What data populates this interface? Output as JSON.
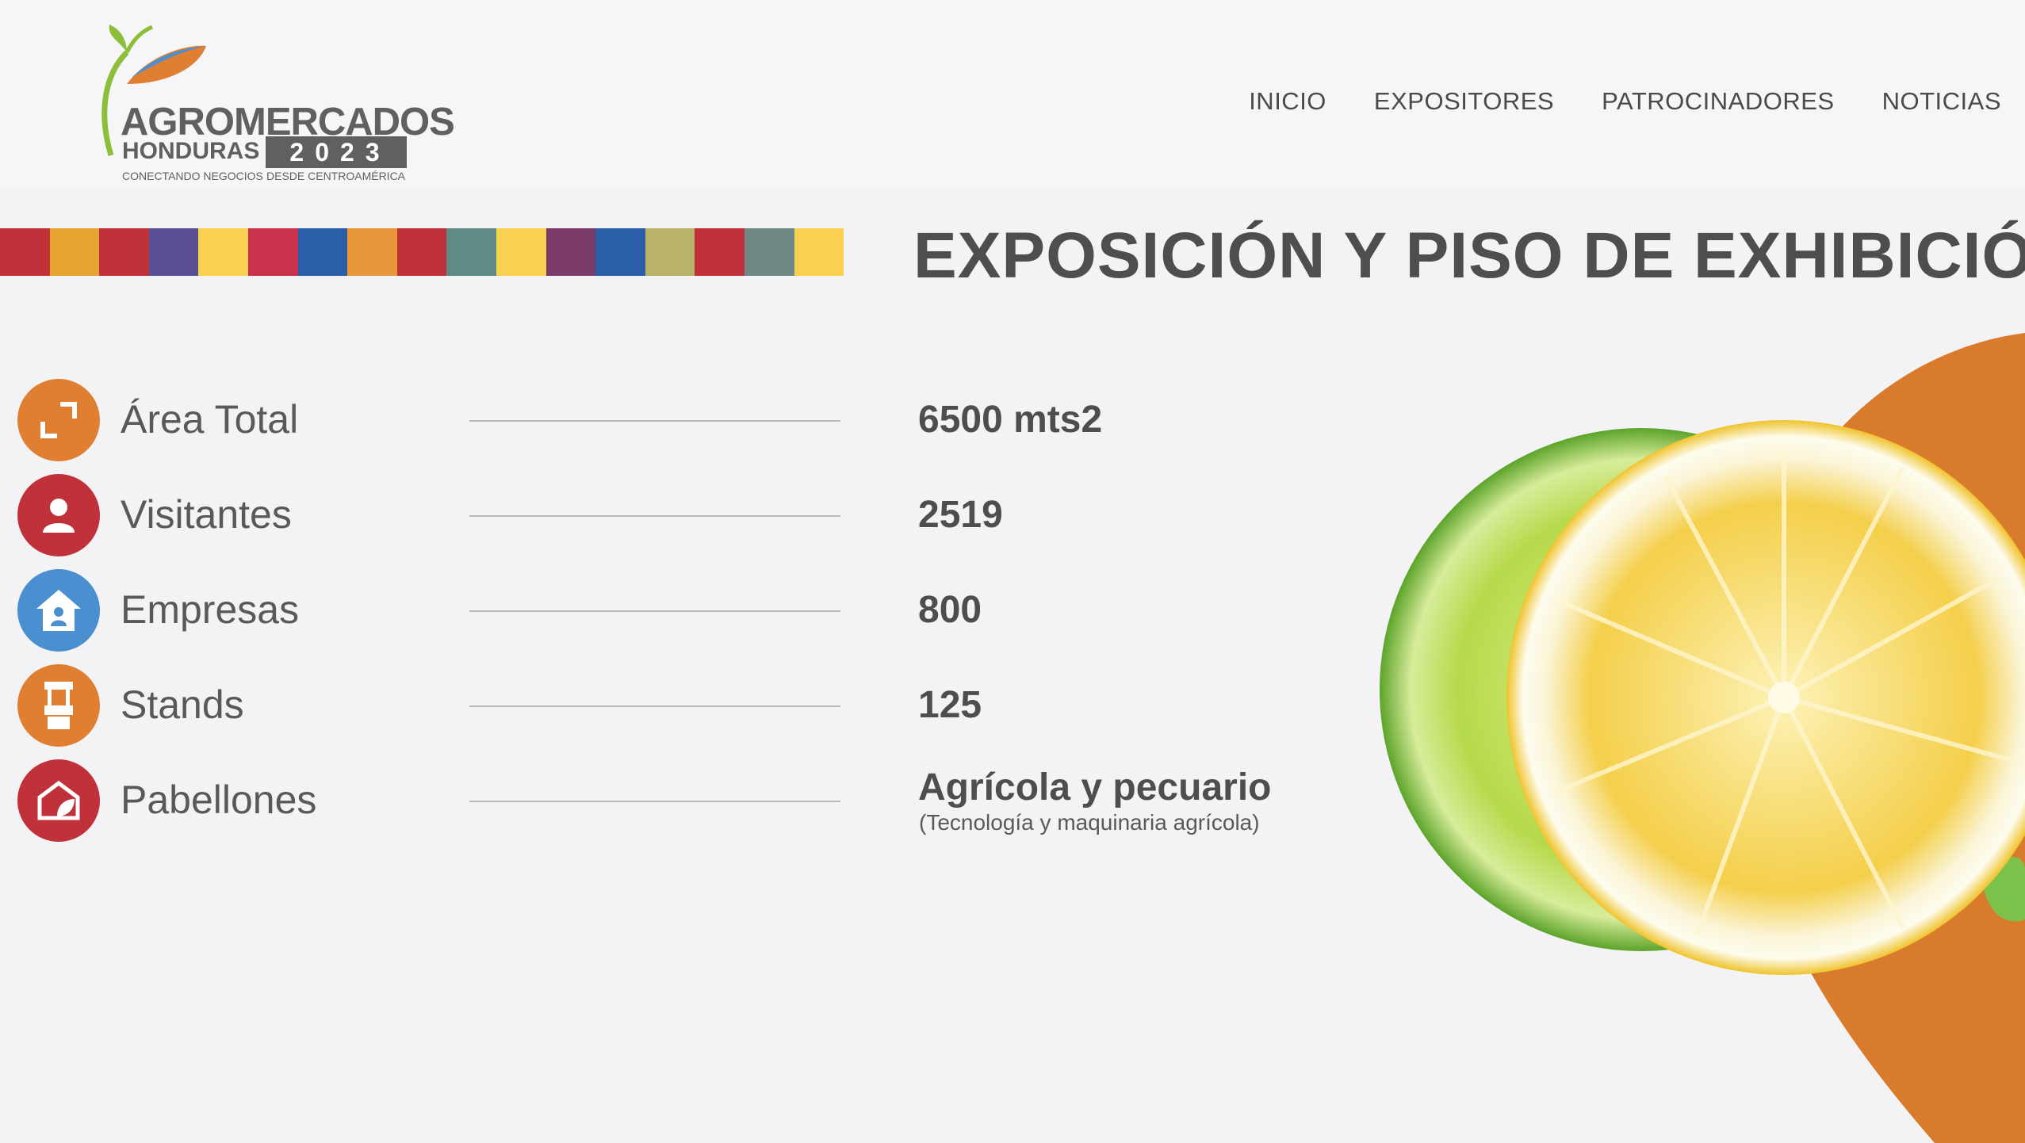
{
  "brand": {
    "name": "AGROMERCADOS",
    "country": "HONDURAS",
    "year": "2023",
    "tagline_left": "CONECTANDO NEGOCIOS",
    "tagline_right": "DESDE CENTROAMÉRICA"
  },
  "nav": {
    "items": [
      {
        "label": "INICIO"
      },
      {
        "label": "EXPOSITORES"
      },
      {
        "label": "PATROCINADORES"
      },
      {
        "label": "NOTICIAS"
      }
    ]
  },
  "section": {
    "title": "EXPOSICIÓN Y PISO DE EXHIBICIÓN"
  },
  "stats": [
    {
      "label": "Área Total",
      "value": "6500 mts2",
      "icon": "expand-icon",
      "color": "#e07f32"
    },
    {
      "label": "Visitantes",
      "value": "2519",
      "icon": "user-icon",
      "color": "#c0313a"
    },
    {
      "label": "Empresas",
      "value": "800",
      "icon": "building-icon",
      "color": "#4a8fcf"
    },
    {
      "label": "Stands",
      "value": "125",
      "icon": "stand-icon",
      "color": "#e07f32"
    },
    {
      "label": "Pabellones",
      "value": "Agrícola y pecuario",
      "note": "(Tecnología y maquinaria agrícola)",
      "icon": "pavilion-icon",
      "color": "#c0313a"
    }
  ],
  "colors": {
    "orange": "#e07f32",
    "red": "#c0313a",
    "blue": "#4a8fcf",
    "yellow": "#f9d04f",
    "text": "#58595b"
  },
  "decor": {
    "pattern_colors": [
      "#c0313a",
      "#e7a431",
      "#c0313a",
      "#5a4f92",
      "#f9d04f",
      "#c8324a",
      "#2b5ea8",
      "#e8983a",
      "#c0313a",
      "#5f8b86",
      "#f9d04f",
      "#7a3a6a",
      "#2b5ea8",
      "#b9b26a",
      "#c0313a",
      "#6f8a86",
      "#f9d04f"
    ],
    "fruit_icon": "citrus-slices-image"
  }
}
